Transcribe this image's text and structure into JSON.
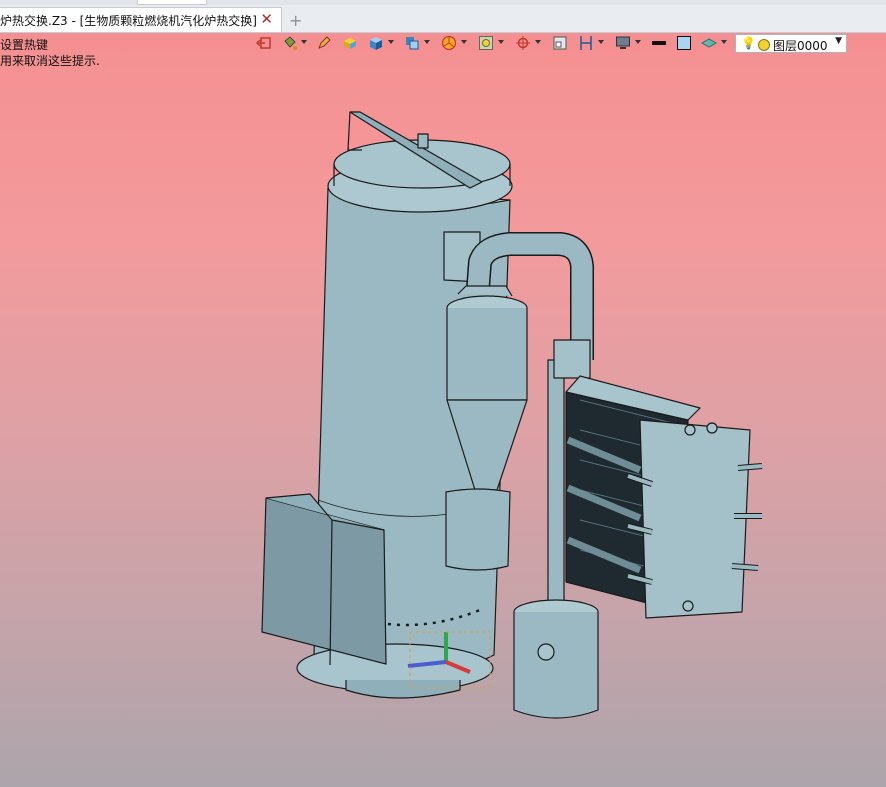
{
  "tab": {
    "title": "炉热交换.Z3 - [生物质颗粒燃烧机汽化炉热交换]",
    "close_icon": "close-icon",
    "new_tab_icon": "plus-icon"
  },
  "hints": {
    "line1": "设置热键",
    "line2": "用来取消这些提示."
  },
  "toolbar": {
    "icons": [
      "exit-icon",
      "paint-bucket-icon",
      "pencil-icon",
      "yellow-block-icon",
      "blue-cube-icon",
      "cube-stack-icon",
      "pie-render-icon",
      "frame-icon",
      "target-icon",
      "maximize-icon",
      "bracket-icon",
      "monitor-icon",
      "line-color-icon",
      "fill-color-icon",
      "layer-stack-icon"
    ],
    "layer": {
      "name": "图层0000",
      "bulb_icon": "bulb-icon",
      "status_icon": "sun-icon"
    }
  },
  "colors": {
    "bg_top": "#f58e90",
    "bg_bottom": "#aca5ab",
    "model": "#9bb9c2",
    "tab_close": "#b52b24"
  }
}
